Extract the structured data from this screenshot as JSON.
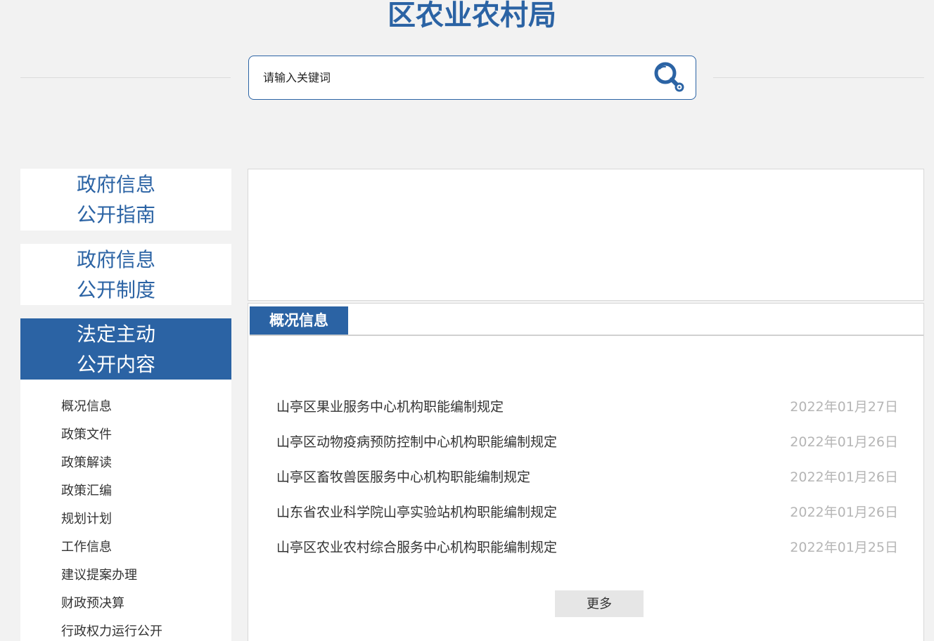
{
  "header": {
    "title": "区农业农村局"
  },
  "search": {
    "placeholder": "请输入关键词",
    "button_icon": "search-key-icon"
  },
  "sidebar": {
    "blocks": [
      {
        "line1": "政府信息",
        "line2": "公开指南",
        "active": false
      },
      {
        "line1": "政府信息",
        "line2": "公开制度",
        "active": false
      },
      {
        "line1": "法定主动",
        "line2": "公开内容",
        "active": true
      }
    ],
    "items": [
      {
        "label": "概况信息"
      },
      {
        "label": "政策文件"
      },
      {
        "label": "政策解读"
      },
      {
        "label": "政策汇编"
      },
      {
        "label": "规划计划"
      },
      {
        "label": "工作信息"
      },
      {
        "label": "建议提案办理"
      },
      {
        "label": "财政预决算"
      },
      {
        "label": "行政权力运行公开"
      }
    ]
  },
  "main": {
    "tab_label": "概况信息",
    "articles": [
      {
        "title": "山亭区果业服务中心机构职能编制规定",
        "date": "2022年01月27日"
      },
      {
        "title": "山亭区动物疫病预防控制中心机构职能编制规定",
        "date": "2022年01月26日"
      },
      {
        "title": "山亭区畜牧兽医服务中心机构职能编制规定",
        "date": "2022年01月26日"
      },
      {
        "title": "山东省农业科学院山亭实验站机构职能编制规定",
        "date": "2022年01月26日"
      },
      {
        "title": "山亭区农业农村综合服务中心机构职能编制规定",
        "date": "2022年01月25日"
      }
    ],
    "more_label": "更多"
  },
  "colors": {
    "brand_blue": "#2b63a4",
    "page_background": "#f2f2f2",
    "date_gray": "#b5b5b5"
  }
}
